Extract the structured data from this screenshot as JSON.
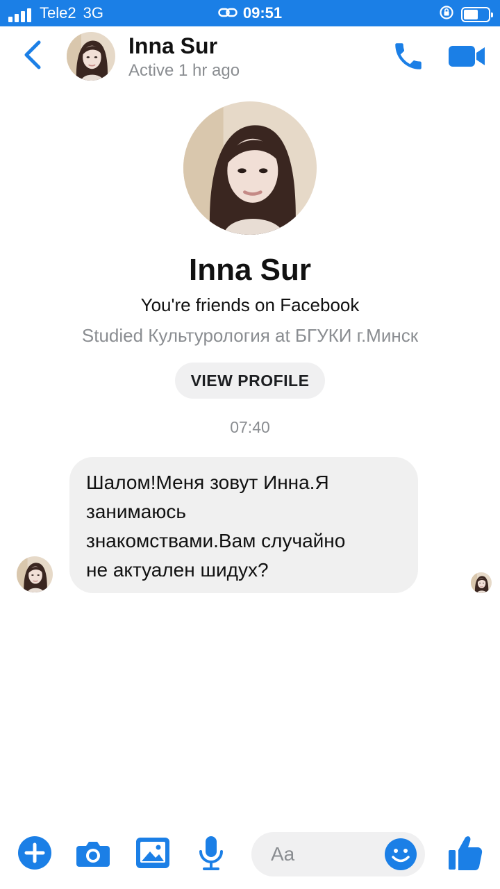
{
  "status_bar": {
    "carrier": "Tele2",
    "network": "3G",
    "time": "09:51",
    "battery_level": 0.6,
    "icons": [
      "signal-icon",
      "link-icon",
      "rotation-lock-icon",
      "battery-icon"
    ]
  },
  "header": {
    "name": "Inna Sur",
    "status": "Active 1 hr ago",
    "icons": [
      "back-icon",
      "phone-icon",
      "video-camera-icon"
    ]
  },
  "profile": {
    "name": "Inna Sur",
    "friends_text": "You're friends on Facebook",
    "studied_text": "Studied Культурология at БГУКИ г.Минск",
    "view_profile_label": "VIEW PROFILE"
  },
  "conversation": {
    "timestamp": "07:40",
    "messages": [
      {
        "line1": "Шалом!Меня зовут Инна.Я",
        "line2": "занимаюсь",
        "line3": "знакомствами.Вам случайно",
        "line4": "не актуален шидух?"
      }
    ]
  },
  "composer": {
    "placeholder": "Aa",
    "icons": [
      "plus-icon",
      "camera-icon",
      "image-icon",
      "microphone-icon",
      "emoji-icon",
      "thumbs-up-icon"
    ]
  },
  "colors": {
    "accent": "#1b7fe6",
    "status_bar_bg": "#1b7fe6",
    "bubble_bg": "#f0f0f0",
    "muted_text": "#8a8d91"
  }
}
